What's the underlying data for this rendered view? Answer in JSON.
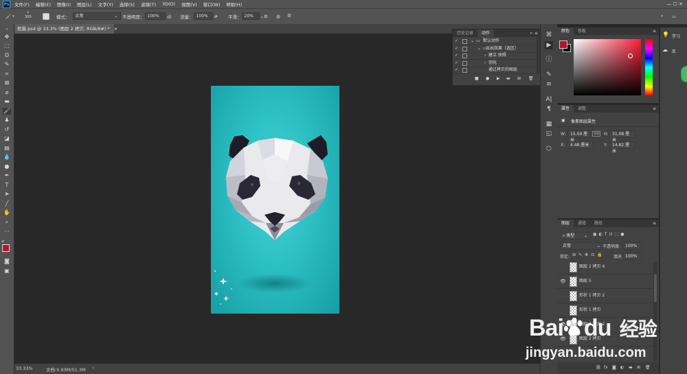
{
  "app": {
    "logo_text": "Ps"
  },
  "menu": [
    "文件(F)",
    "编辑(E)",
    "图像(I)",
    "图层(L)",
    "文字(Y)",
    "选择(S)",
    "滤镜(T)",
    "3D(D)",
    "视图(V)",
    "窗口(W)",
    "帮助(H)"
  ],
  "options": {
    "brush_size": "300",
    "mode_label": "模式：",
    "mode_value": "正常",
    "opacity_label": "不透明度：",
    "opacity_value": "100%",
    "flow_label": "流量：",
    "flow_value": "100%",
    "smoothing_label": "平滑：",
    "smoothing_value": "20%"
  },
  "document": {
    "tab_title": "熊猫.psd @ 33.3% (图层 2 拷贝, RGB/8#) *",
    "tab_close": "×"
  },
  "status": {
    "zoom": "33.33%",
    "doc_info": "文档:5.93M/51.3M",
    "arrow": "›"
  },
  "actions_panel": {
    "tabs": [
      "历史记录",
      "动作"
    ],
    "active_tab": "动作",
    "collapse": "»",
    "menu": "≡",
    "rows": [
      {
        "check": "✓",
        "expander": "⌄",
        "label": "默认动作",
        "indent": 0
      },
      {
        "check": "✓",
        "expander": "⌄",
        "label": "淡出效果（选区）",
        "indent": 1
      },
      {
        "check": "✓",
        "expander": "›",
        "label": "建立 快照",
        "indent": 2
      },
      {
        "check": "✓",
        "expander": "›",
        "label": "羽化",
        "indent": 2
      },
      {
        "check": "✓",
        "expander": "",
        "label": "通过拷贝的图层",
        "indent": 2
      }
    ]
  },
  "color_panel": {
    "tabs": [
      "颜色",
      "色板"
    ],
    "active_tab": "颜色",
    "foreground": "#b3142d",
    "background": "#000000"
  },
  "properties_panel": {
    "tabs": [
      "属性",
      "调整"
    ],
    "active_tab": "属性",
    "title": "像素图层属性",
    "w_label": "W:",
    "w_value": "15.59 厘米",
    "h_label": "H:",
    "h_value": "31.08 厘米",
    "x_label": "X:",
    "x_value": "4.48 厘米",
    "y_label": "Y:",
    "y_value": "14.82 厘米",
    "link_icon": "⊙⊙"
  },
  "layers_panel": {
    "tabs": [
      "图层",
      "通道",
      "路径"
    ],
    "active_tab": "图层",
    "filter_kind": "类型",
    "blend_mode": "正常",
    "opacity_label": "不透明度:",
    "opacity_value": "100%",
    "lock_label": "锁定:",
    "fill_label": "填充:",
    "fill_value": "100%",
    "layers": [
      {
        "name": "图层 2 拷贝 4",
        "visible": false
      },
      {
        "name": "图层 5",
        "visible": true
      },
      {
        "name": "形状 1 拷贝 2",
        "visible": false
      },
      {
        "name": "形状 1 拷贝",
        "visible": false
      },
      {
        "name": "图层 2 拷贝 2",
        "visible": true
      },
      {
        "name": "图层 2 拷贝",
        "visible": true
      }
    ]
  },
  "learn_panel": {
    "items": [
      {
        "icon": "lightbulb-icon",
        "label": "学习"
      },
      {
        "icon": "library-icon",
        "label": "库"
      }
    ]
  },
  "watermark": {
    "brand_text": "Bai",
    "brand_text2": "du",
    "brand_cn": "经验",
    "url": "jingyan.baidu.com"
  },
  "colors": {
    "canvas_teal": "#2cbfc2",
    "accent_blue": "#31a8ff",
    "panel_bg": "#424242"
  }
}
